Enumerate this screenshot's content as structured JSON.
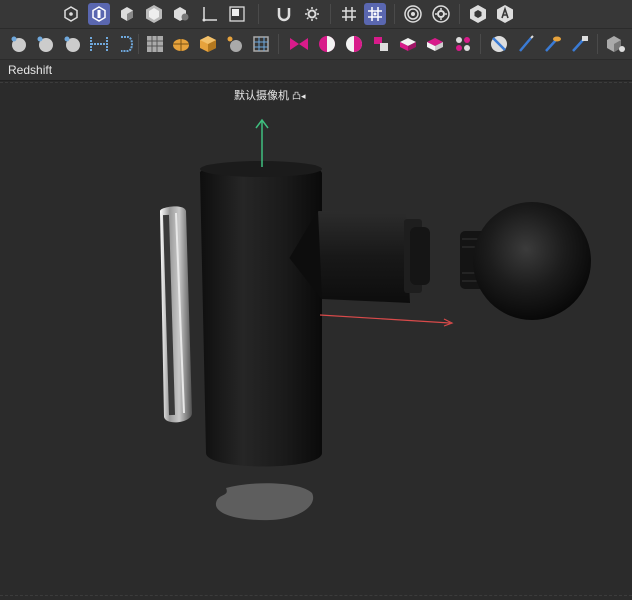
{
  "toolbar": {
    "row1_icons": [
      "vertex-select-icon",
      "face-select-icon",
      "object-select-icon",
      "multi-select-icon",
      "soft-select-icon",
      "axis-orient-icon",
      "snap-box-icon",
      "magnet-snap-icon",
      "snap-settings-icon",
      "grid-snap-icon",
      "grid-snap-active-icon",
      "target-ring-icon",
      "gear-ring-icon",
      "hex-icon",
      "letter-a-icon"
    ],
    "row2_icons": [
      "sphere-tool-icon",
      "cone-tool-icon",
      "torus-tool-icon",
      "bridge-tool-icon",
      "bracket-tool-icon",
      "grid-tool-icon",
      "wedge-tool-icon",
      "box-tool-icon",
      "smooth-tool-icon",
      "lattice-tool-icon",
      "bowtie-tool-icon",
      "half-sphere-pink-icon",
      "half-sphere-split-icon",
      "cluster-tool-icon",
      "box-pink-icon",
      "box-split-icon",
      "dots-pink-icon",
      "slice-tool-icon",
      "pen-tool-icon",
      "eyedropper-tool-icon",
      "brush-tool-icon",
      "cube-settings-icon"
    ]
  },
  "shelf": {
    "label": "Redshift"
  },
  "viewport": {
    "camera_label": "默认摄像机",
    "camera_suffix": "凸◂"
  },
  "colors": {
    "accent": "#5a67b0",
    "pink": "#d81b8a",
    "background": "#2b2b2b",
    "gizmo_y": "#3fbf7f",
    "gizmo_x": "#d94a4a"
  }
}
